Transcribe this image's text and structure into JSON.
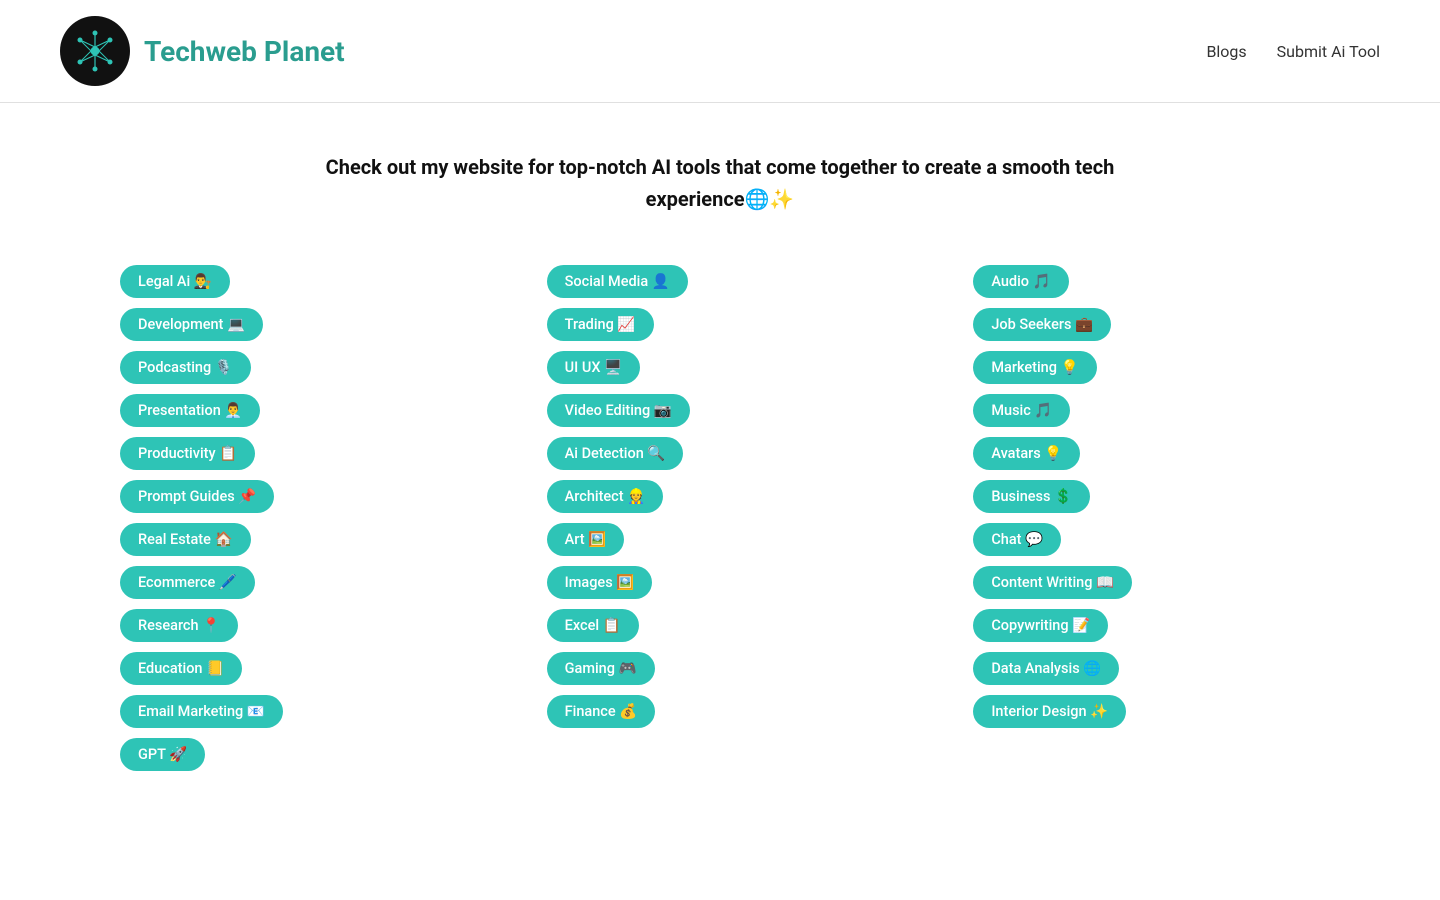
{
  "header": {
    "site_title": "Techweb Planet",
    "nav": {
      "blogs_label": "Blogs",
      "submit_label": "Submit Ai Tool"
    }
  },
  "hero": {
    "text": "Check out my website for top-notch AI tools that come together to create a smooth tech experience🌐✨"
  },
  "columns": [
    {
      "id": "col1",
      "items": [
        {
          "label": "Legal Ai 👨‍⚖️"
        },
        {
          "label": "Development 💻"
        },
        {
          "label": "Podcasting 🎙️"
        },
        {
          "label": "Presentation 👨‍💼"
        },
        {
          "label": "Productivity 📋"
        },
        {
          "label": "Prompt Guides 📌"
        },
        {
          "label": "Real Estate 🏠"
        },
        {
          "label": "Ecommerce 🖊️"
        },
        {
          "label": "Research 📍"
        },
        {
          "label": "Education 📒"
        },
        {
          "label": "Email Marketing 📧"
        },
        {
          "label": "GPT 🚀"
        }
      ]
    },
    {
      "id": "col2",
      "items": [
        {
          "label": "Social Media 👤"
        },
        {
          "label": "Trading 📈"
        },
        {
          "label": "UI UX 🖥️"
        },
        {
          "label": "Video Editing 📷"
        },
        {
          "label": "Ai Detection 🔍"
        },
        {
          "label": "Architect 👷"
        },
        {
          "label": "Art 🖼️"
        },
        {
          "label": "Images 🖼️"
        },
        {
          "label": "Excel 📋"
        },
        {
          "label": "Gaming 🎮"
        },
        {
          "label": "Finance 💰"
        }
      ]
    },
    {
      "id": "col3",
      "items": [
        {
          "label": "Audio 🎵"
        },
        {
          "label": "Job Seekers 💼"
        },
        {
          "label": "Marketing 💡"
        },
        {
          "label": "Music 🎵"
        },
        {
          "label": "Avatars 💡"
        },
        {
          "label": "Business 💲"
        },
        {
          "label": "Chat 💬"
        },
        {
          "label": "Content Writing 📖"
        },
        {
          "label": "Copywriting 📝"
        },
        {
          "label": "Data Analysis 🌐"
        },
        {
          "label": "Interior Design ✨"
        }
      ]
    }
  ]
}
